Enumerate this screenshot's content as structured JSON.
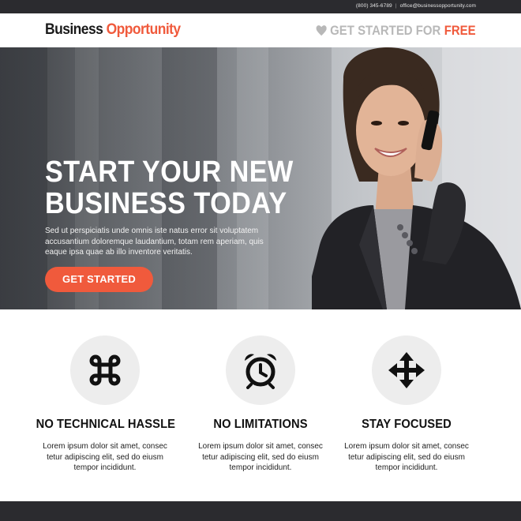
{
  "topbar": {
    "phone": "(800) 345-6789",
    "separator": "|",
    "email": "office@businessopportunity.com"
  },
  "header": {
    "logo_word1": "Business",
    "logo_word2": "Opportunity",
    "cta_text": "GET STARTED FOR",
    "cta_highlight": "FREE",
    "icon": "heart-icon"
  },
  "hero": {
    "headline_line1": "START YOUR NEW",
    "headline_line2": "BUSINESS TODAY",
    "body": "Sed ut perspiciatis unde omnis iste natus error sit voluptatem accusantium doloremque laudantium, totam rem aperiam, quis eaque ipsa quae ab illo inventore veritatis.",
    "button_label": "GET STARTED",
    "image": "woman-on-phone-photo"
  },
  "features": [
    {
      "icon": "command-icon",
      "title": "NO TECHNICAL HASSLE",
      "text": "Lorem ipsum dolor sit amet, consec tetur adipiscing elit, sed do eiusm tempor incididunt."
    },
    {
      "icon": "alarm-clock-icon",
      "title": "NO LIMITATIONS",
      "text": "Lorem ipsum dolor sit amet, consec tetur adipiscing elit, sed do eiusm tempor incididunt."
    },
    {
      "icon": "move-arrows-icon",
      "title": "STAY FOCUSED",
      "text": "Lorem ipsum dolor sit amet, consec tetur adipiscing elit, sed do eiusm tempor incididunt."
    }
  ],
  "colors": {
    "accent": "#f05a3c",
    "dark_bar": "#2b2b2f",
    "icon_circle": "#ededed"
  }
}
